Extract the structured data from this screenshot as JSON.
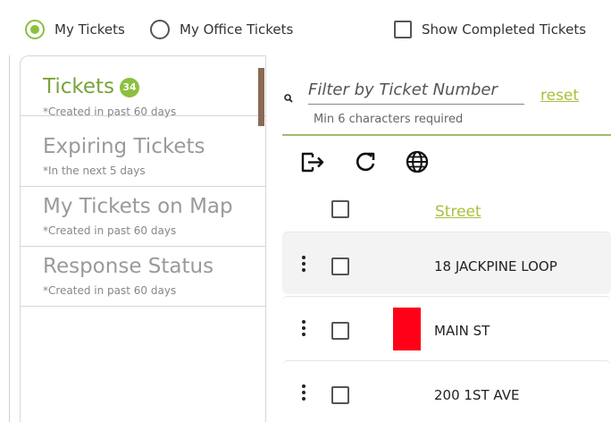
{
  "filters": {
    "my_tickets": {
      "label": "My Tickets",
      "selected": true
    },
    "my_office_tickets": {
      "label": "My Office Tickets",
      "selected": false
    },
    "show_completed": {
      "label": "Show Completed Tickets",
      "checked": false
    }
  },
  "sidebar": {
    "items": [
      {
        "title": "Tickets",
        "badge": "34",
        "subtitle": "*Created in past 60 days",
        "active": true
      },
      {
        "title": "Expiring Tickets",
        "subtitle": "*In the next 5 days",
        "active": false
      },
      {
        "title": "My Tickets on Map",
        "subtitle": "*Created in past 60 days",
        "active": false
      },
      {
        "title": "Response Status",
        "subtitle": "*Created in past 60 days",
        "active": false
      }
    ]
  },
  "search": {
    "placeholder": "Filter by Ticket Number",
    "value": "",
    "hint": "Min 6 characters required",
    "reset_label": "reset"
  },
  "toolbar": {
    "icons": [
      "export-icon",
      "refresh-icon",
      "globe-icon"
    ]
  },
  "table": {
    "columns": [
      "Street"
    ],
    "rows": [
      {
        "street": "18 JACKPINE LOOP",
        "flag": false
      },
      {
        "street": "MAIN ST",
        "flag": true,
        "flag_color": "#ff0018"
      },
      {
        "street": "200 1ST AVE",
        "flag": false
      }
    ]
  },
  "colors": {
    "accent": "#8cbf3f",
    "link": "#a8bf3a",
    "active_marker": "#8b6a55",
    "flag": "#ff0018"
  }
}
